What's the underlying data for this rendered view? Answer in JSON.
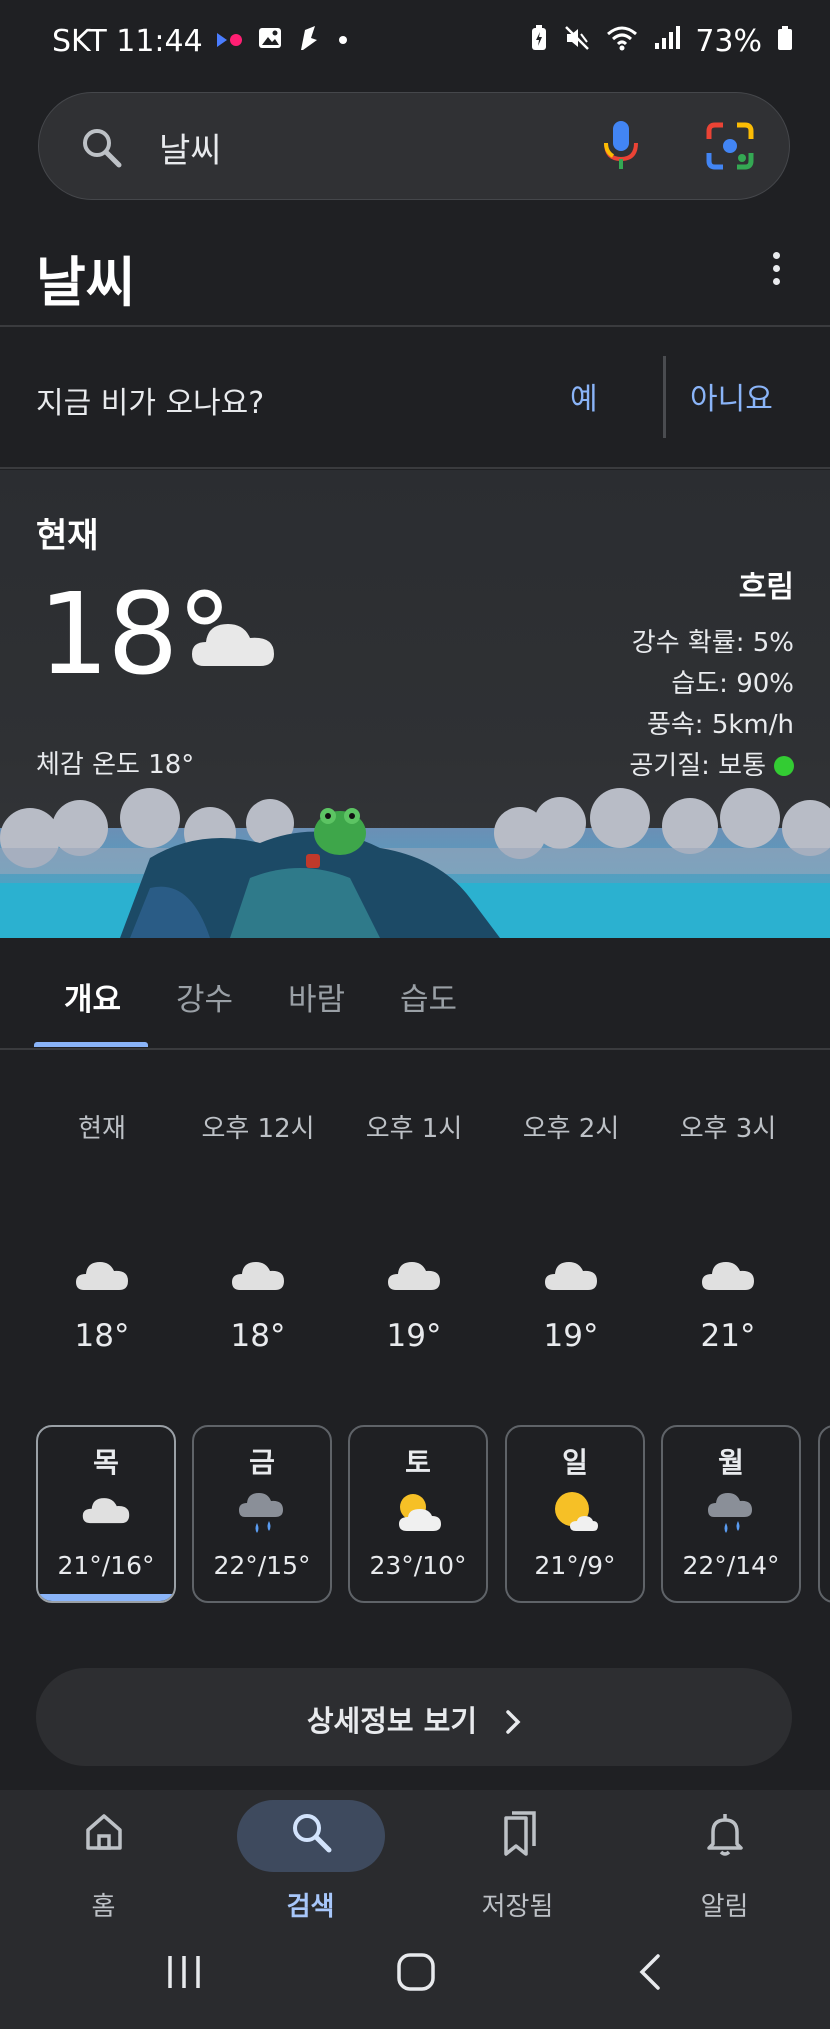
{
  "status_bar": {
    "carrier_time": "SKT 11:44",
    "battery": "73%",
    "icons": [
      "flickr-icon",
      "gallery-icon",
      "app-icon",
      "dot-icon",
      "battery-saver-icon",
      "mute-icon",
      "wifi-icon",
      "signal-icon",
      "battery-icon"
    ]
  },
  "search": {
    "query": "날씨",
    "icons": [
      "search-icon",
      "mic-icon",
      "lens-icon"
    ]
  },
  "header": {
    "title": "날씨"
  },
  "rain_question": {
    "text": "지금 비가 오나요?",
    "yes": "예",
    "no": "아니요"
  },
  "current": {
    "label": "현재",
    "temperature": "18°",
    "feels_like": "체감 온도 18°",
    "condition": "흐림",
    "precipitation": "강수 확률: 5%",
    "humidity": "습도: 90%",
    "wind": "풍속: 5km/h",
    "air_quality": "공기질: 보통",
    "air_quality_color": "#33cc33"
  },
  "tabs": [
    {
      "label": "개요",
      "active": true
    },
    {
      "label": "강수",
      "active": false
    },
    {
      "label": "바람",
      "active": false
    },
    {
      "label": "습도",
      "active": false
    }
  ],
  "hourly": [
    {
      "time": "현재",
      "temp": "18°",
      "icon": "cloud-icon"
    },
    {
      "time": "오후 12시",
      "temp": "18°",
      "icon": "cloud-icon"
    },
    {
      "time": "오후 1시",
      "temp": "19°",
      "icon": "cloud-icon"
    },
    {
      "time": "오후 2시",
      "temp": "19°",
      "icon": "cloud-icon"
    },
    {
      "time": "오후 3시",
      "temp": "21°",
      "icon": "cloud-icon"
    }
  ],
  "daily": [
    {
      "day": "목",
      "temps": "21°/16°",
      "icon": "cloud-icon",
      "selected": true
    },
    {
      "day": "금",
      "temps": "22°/15°",
      "icon": "rain-cloud-icon",
      "selected": false
    },
    {
      "day": "토",
      "temps": "23°/10°",
      "icon": "partly-cloudy-icon",
      "selected": false
    },
    {
      "day": "일",
      "temps": "21°/9°",
      "icon": "mostly-sunny-icon",
      "selected": false
    },
    {
      "day": "월",
      "temps": "22°/14°",
      "icon": "rain-cloud-icon",
      "selected": false
    }
  ],
  "details_button": {
    "label": "상세정보 보기"
  },
  "bottom_nav": [
    {
      "label": "홈",
      "icon": "home-icon",
      "active": false
    },
    {
      "label": "검색",
      "icon": "search-icon",
      "active": true
    },
    {
      "label": "저장됨",
      "icon": "bookmarks-icon",
      "active": false
    },
    {
      "label": "알림",
      "icon": "bell-icon",
      "active": false
    }
  ],
  "colors": {
    "background": "#1f2023",
    "accent": "#8ab4f8",
    "nav_active": "#a8c7fa"
  }
}
